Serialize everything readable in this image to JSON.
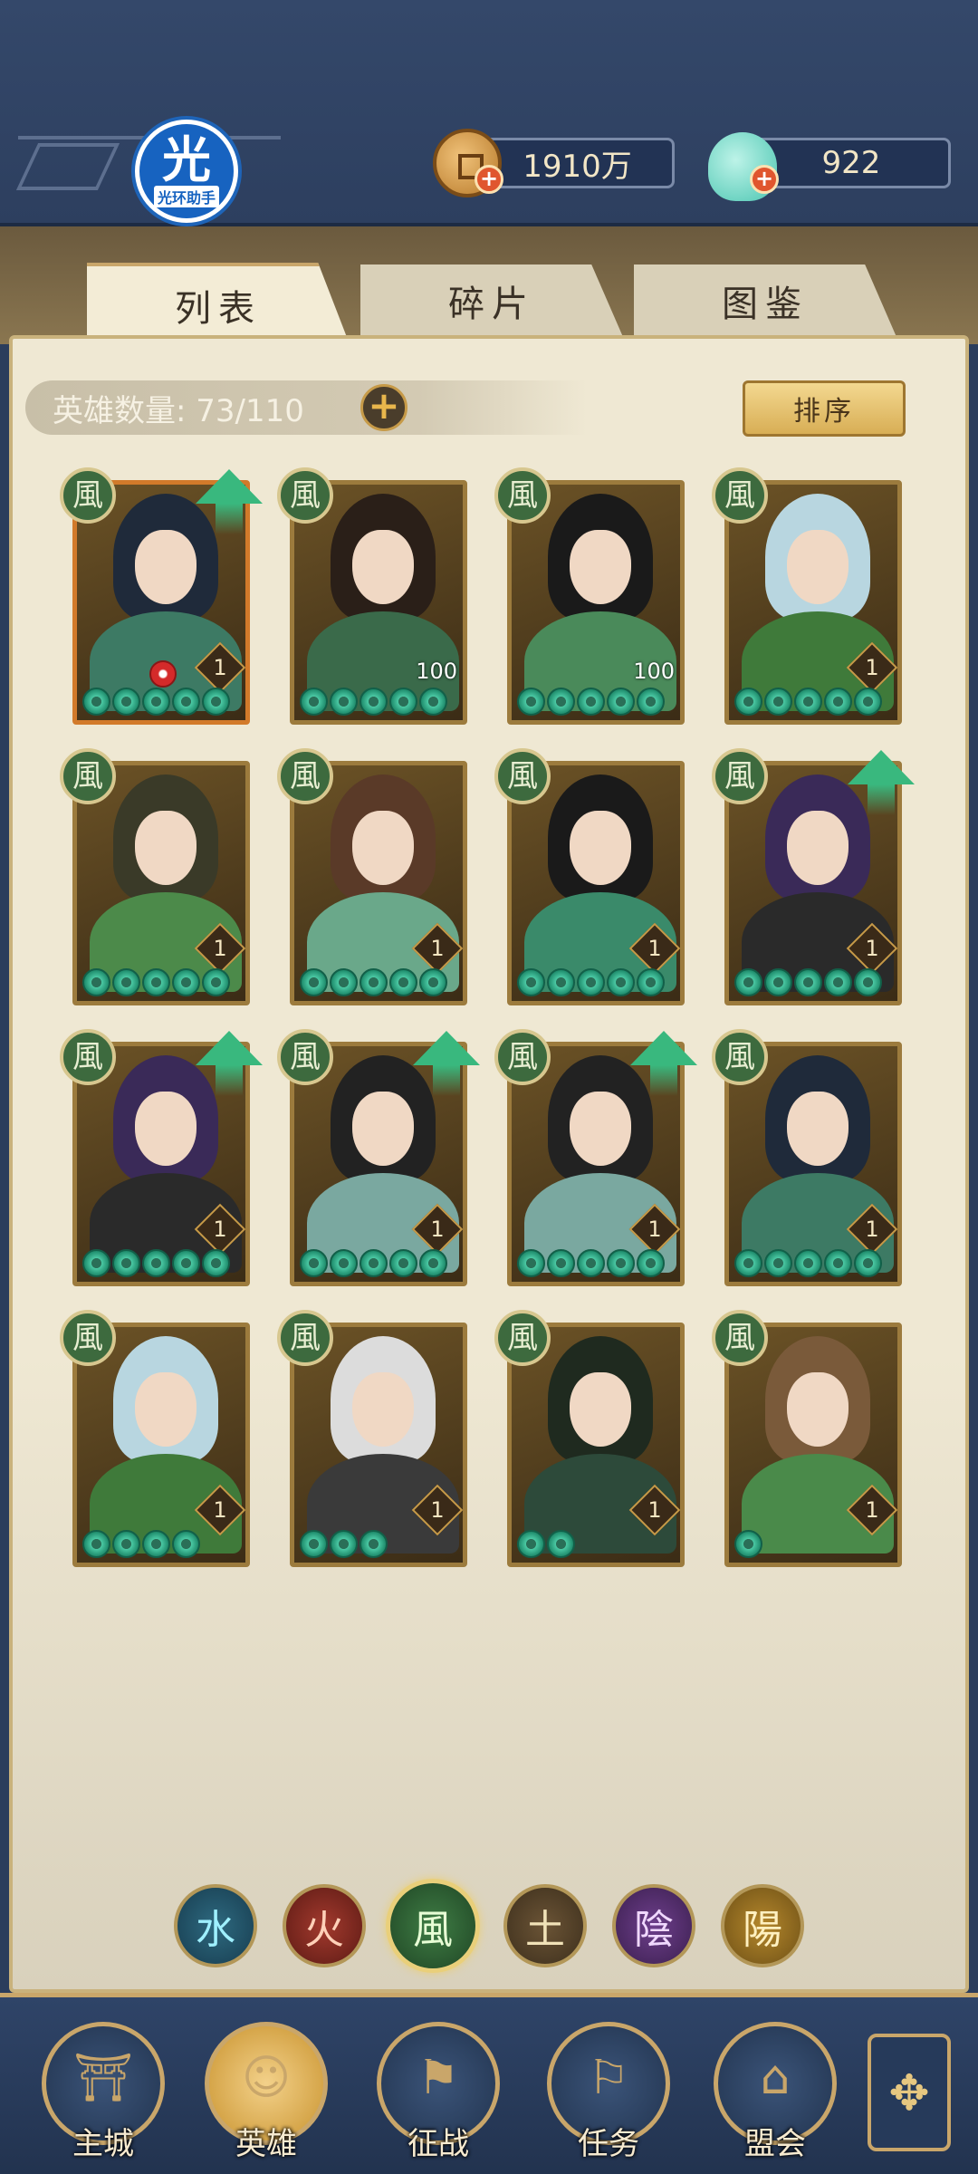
{
  "header": {
    "logo": {
      "glyph": "光",
      "text": "光环助手"
    },
    "gold": {
      "value": "1910万",
      "icon": "copper-coin-icon"
    },
    "gems": {
      "value": "922",
      "icon": "jade-shell-icon"
    }
  },
  "tabs": [
    {
      "label": "列表",
      "active": true
    },
    {
      "label": "碎片",
      "active": false
    },
    {
      "label": "图鉴",
      "active": false
    }
  ],
  "roster": {
    "count_label": "英雄数量: 73/110",
    "sort_label": "排序"
  },
  "heroes": [
    {
      "element": "風",
      "stars": 5,
      "level": "1",
      "upgrade": true,
      "frame": "orange"
    },
    {
      "element": "風",
      "stars": 5,
      "tag": "100",
      "upgrade": false
    },
    {
      "element": "風",
      "stars": 5,
      "tag": "100",
      "upgrade": false
    },
    {
      "element": "風",
      "stars": 5,
      "level": "1",
      "upgrade": false
    },
    {
      "element": "風",
      "stars": 5,
      "level": "1",
      "upgrade": false
    },
    {
      "element": "風",
      "stars": 5,
      "level": "1",
      "upgrade": false
    },
    {
      "element": "風",
      "stars": 5,
      "level": "1",
      "upgrade": false
    },
    {
      "element": "風",
      "stars": 5,
      "level": "1",
      "upgrade": true
    },
    {
      "element": "風",
      "stars": 5,
      "level": "1",
      "upgrade": true
    },
    {
      "element": "風",
      "stars": 5,
      "level": "1",
      "upgrade": true
    },
    {
      "element": "風",
      "stars": 5,
      "level": "1",
      "upgrade": true
    },
    {
      "element": "風",
      "stars": 5,
      "level": "1",
      "upgrade": false
    },
    {
      "element": "風",
      "stars": 4,
      "level": "1",
      "upgrade": false
    },
    {
      "element": "風",
      "stars": 3,
      "level": "1",
      "upgrade": false
    },
    {
      "element": "風",
      "stars": 2,
      "level": "1",
      "upgrade": false
    },
    {
      "element": "風",
      "stars": 1,
      "level": "1",
      "upgrade": false
    }
  ],
  "element_filters": [
    {
      "glyph": "水",
      "name": "water",
      "active": false
    },
    {
      "glyph": "火",
      "name": "fire",
      "active": false
    },
    {
      "glyph": "風",
      "name": "wind",
      "active": true
    },
    {
      "glyph": "土",
      "name": "earth",
      "active": false
    },
    {
      "glyph": "陰",
      "name": "yin",
      "active": false
    },
    {
      "glyph": "陽",
      "name": "yang",
      "active": false
    }
  ],
  "nav": [
    {
      "label": "主城",
      "icon": "city-gate-icon",
      "active": false
    },
    {
      "label": "英雄",
      "icon": "hero-portrait-icon",
      "active": true
    },
    {
      "label": "征战",
      "icon": "battle-banner-icon",
      "active": false
    },
    {
      "label": "任务",
      "icon": "scroll-flag-icon",
      "active": false
    },
    {
      "label": "盟会",
      "icon": "pavilion-icon",
      "active": false
    }
  ],
  "menu": {
    "glyph": "✥",
    "icon": "flower-menu-icon"
  },
  "colors": {
    "frame_gold": "#9c7b3d",
    "wind_green": "#3d6a3e",
    "parchment": "#efe8d3",
    "header_blue": "#2d3f5f"
  }
}
